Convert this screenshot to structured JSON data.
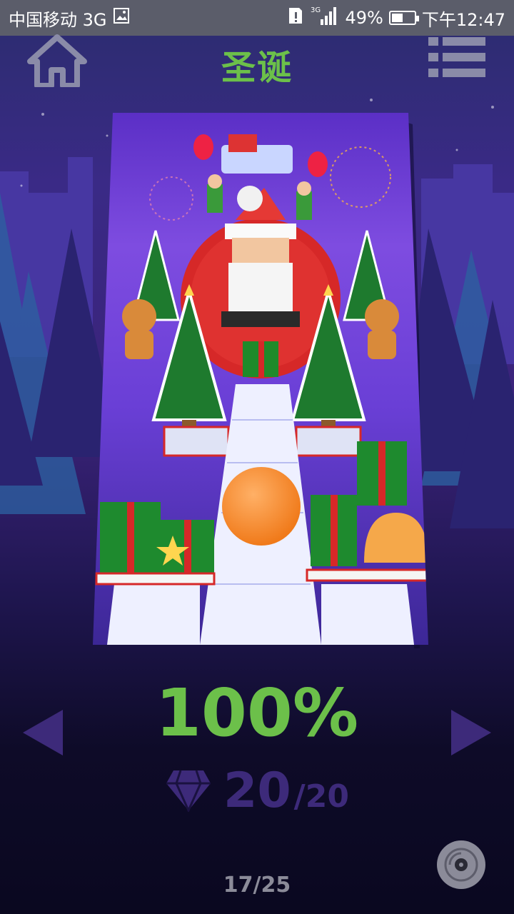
{
  "status_bar": {
    "carrier": "中国移动 3G",
    "network_label": "3G",
    "battery": "49%",
    "battery_level": 0.49,
    "time": "下午12:47"
  },
  "header": {
    "title": "圣诞",
    "home_icon": "home-icon",
    "menu_icon": "list-menu-icon"
  },
  "level": {
    "progress": "100%",
    "gems_collected": "20",
    "gems_total": "/20",
    "gem_icon": "diamond-icon",
    "page": "17/25"
  },
  "nav": {
    "prev_icon": "triangle-left-icon",
    "next_icon": "triangle-right-icon",
    "music_icon": "disc-icon"
  },
  "colors": {
    "accent_green": "#6cc04a",
    "gem_purple": "#3d2a7a",
    "status_bar": "#5b5d6a"
  }
}
